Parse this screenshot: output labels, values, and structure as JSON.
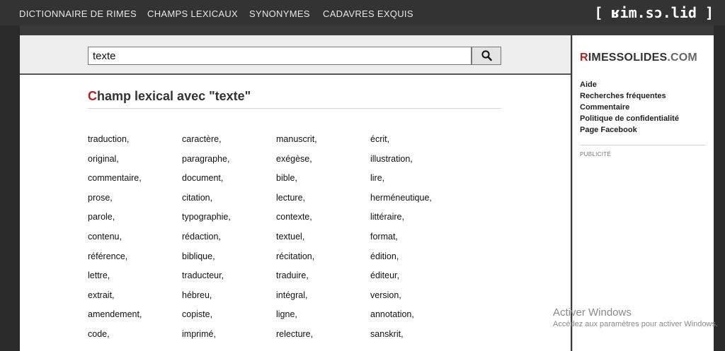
{
  "nav": {
    "items": [
      "DICTIONNAIRE DE RIMES",
      "CHAMPS LEXICAUX",
      "SYNONYMES",
      "CADAVRES EXQUIS"
    ],
    "brand": "[ ʁim.sɔ.lid ]"
  },
  "search": {
    "value": "texte",
    "button_icon": "search-icon"
  },
  "heading": {
    "initial": "C",
    "rest": "hamp lexical avec \"texte\""
  },
  "words": [
    [
      "traduction,",
      "caractère,",
      "manuscrit,",
      "écrit,"
    ],
    [
      "original,",
      "paragraphe,",
      "exégèse,",
      "illustration,"
    ],
    [
      "commentaire,",
      "document,",
      "bible,",
      "lire,"
    ],
    [
      "prose,",
      "citation,",
      "lecture,",
      "herméneutique,"
    ],
    [
      "parole,",
      "typographie,",
      "contexte,",
      "littéraire,"
    ],
    [
      "contenu,",
      "rédaction,",
      "textuel,",
      "format,"
    ],
    [
      "référence,",
      "biblique,",
      "récitation,",
      "édition,"
    ],
    [
      "lettre,",
      "traducteur,",
      "traduire,",
      "éditeur,"
    ],
    [
      "extrait,",
      "hébreu,",
      "intégral,",
      "version,"
    ],
    [
      "amendement,",
      "copiste,",
      "ligne,",
      "annotation,"
    ],
    [
      "code,",
      "imprimé,",
      "relecture,",
      "sanskrit,"
    ]
  ],
  "sidebar": {
    "logo_initial": "R",
    "logo_main": "IMESSOLIDES",
    "logo_domain": ".COM",
    "links": [
      "Aide",
      "Recherches fréquentes",
      "Commentaire",
      "Politique de confidentialité",
      "Page Facebook"
    ],
    "ad_label": "PUBLICITÉ"
  },
  "watermark": {
    "title": "Activer Windows",
    "subtitle": "Accédez aux paramètres pour activer Windows."
  },
  "colors": {
    "accent": "#b22222",
    "nav_background": "#333333",
    "search_area": "#eeeeee"
  }
}
